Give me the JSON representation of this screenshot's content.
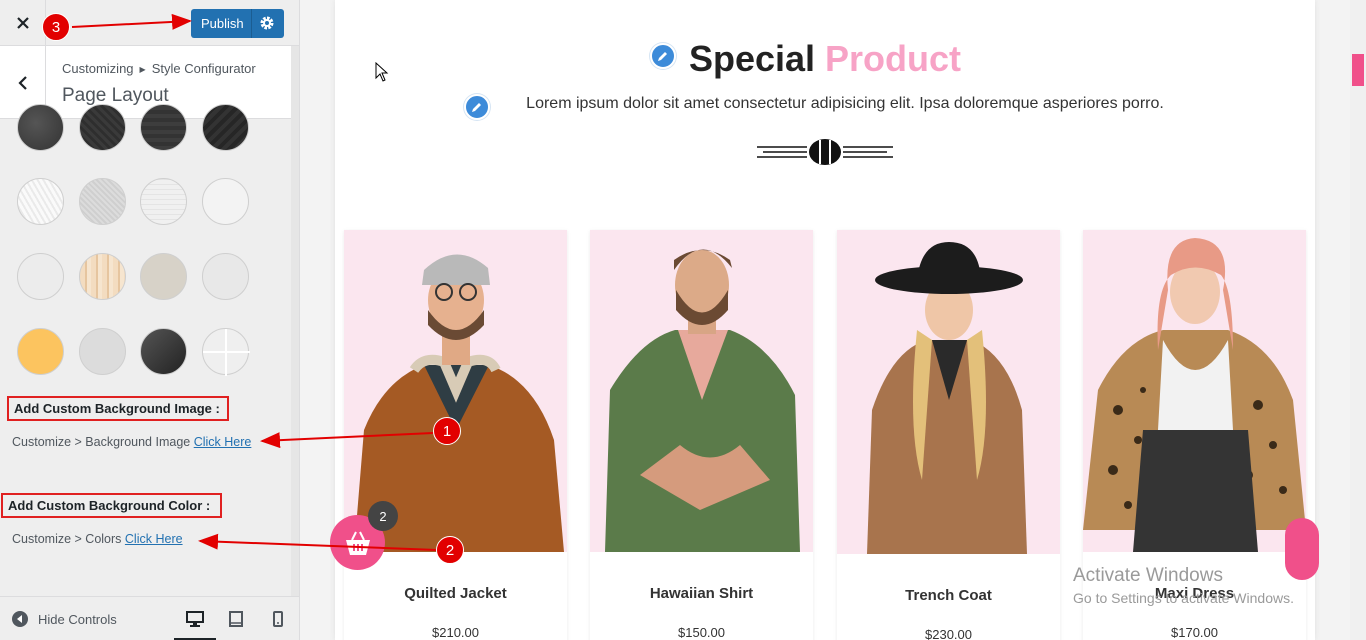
{
  "topbar": {
    "publish_label": "Publish"
  },
  "section": {
    "crumb_root": "Customizing",
    "crumb_child": "Style Configurator",
    "title": "Page Layout"
  },
  "patterns": [
    "dark-texture-1",
    "dark-texture-2",
    "dark-texture-3",
    "dark-texture-4",
    "light-texture-1",
    "light-texture-2",
    "light-texture-3",
    "light-texture-4",
    "light-texture-5",
    "wood-texture",
    "beige-texture",
    "light-texture-6",
    "yellow",
    "light-gray",
    "dark-gray",
    "grid-light"
  ],
  "bg_image": {
    "label": "Add Custom Background Image :",
    "path": "Customize > Background Image",
    "link": "Click Here"
  },
  "bg_color": {
    "label": "Add Custom Background Color :",
    "path": "Customize > Colors",
    "link": "Click Here"
  },
  "footer": {
    "hide_controls": "Hide Controls"
  },
  "markers": {
    "one": "1",
    "two": "2",
    "three": "3"
  },
  "preview": {
    "heading_main": "Special",
    "heading_accent": "Product",
    "subtitle": "Lorem ipsum dolor sit amet consectetur adipisicing elit. Ipsa doloremque asperiores porro.",
    "cart_count": "2",
    "products": [
      {
        "name": "Quilted Jacket",
        "price": "$210.00"
      },
      {
        "name": "Hawaiian Shirt",
        "price": "$150.00"
      },
      {
        "name": "Trench Coat",
        "price": "$230.00"
      },
      {
        "name": "Maxi Dress",
        "price": "$170.00"
      }
    ],
    "watermark_line1": "Activate Windows",
    "watermark_line2": "Go to Settings to activate Windows."
  },
  "colors": {
    "accent": "#f0508a",
    "accent_light": "#f7a3c6",
    "wp_blue": "#2271b1",
    "annotation_red": "#e20000"
  }
}
